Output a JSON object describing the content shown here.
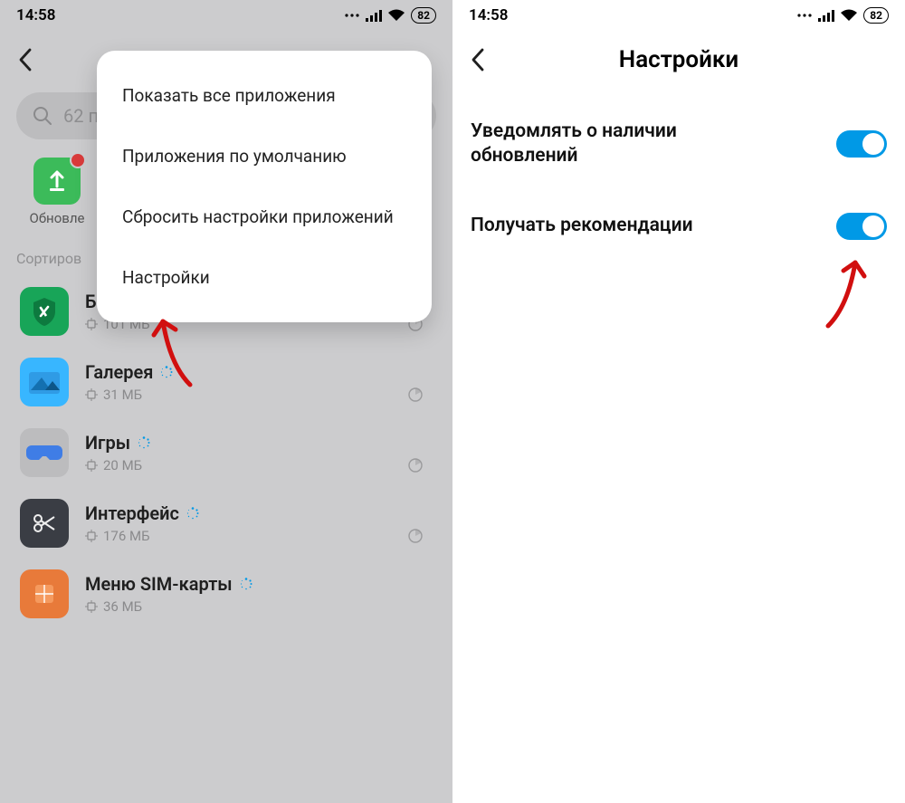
{
  "status": {
    "time": "14:58",
    "battery": "82"
  },
  "left": {
    "search_text": "62 п",
    "shortcut_label": "Обновле",
    "sort_label": "Сортиров",
    "popup": [
      "Показать все приложения",
      "Приложения по умолчанию",
      "Сбросить настройки приложений",
      "Настройки"
    ],
    "apps": [
      {
        "name": "Безопасность",
        "size": "101 МБ"
      },
      {
        "name": "Галерея",
        "size": "31 МБ"
      },
      {
        "name": "Игры",
        "size": "20 МБ"
      },
      {
        "name": "Интерфейс",
        "size": "176 МБ"
      },
      {
        "name": "Меню SIM-карты",
        "size": "36 МБ"
      }
    ]
  },
  "right": {
    "title": "Настройки",
    "settings": [
      {
        "label": "Уведомлять о наличии обновлений"
      },
      {
        "label": "Получать рекомендации"
      }
    ]
  }
}
